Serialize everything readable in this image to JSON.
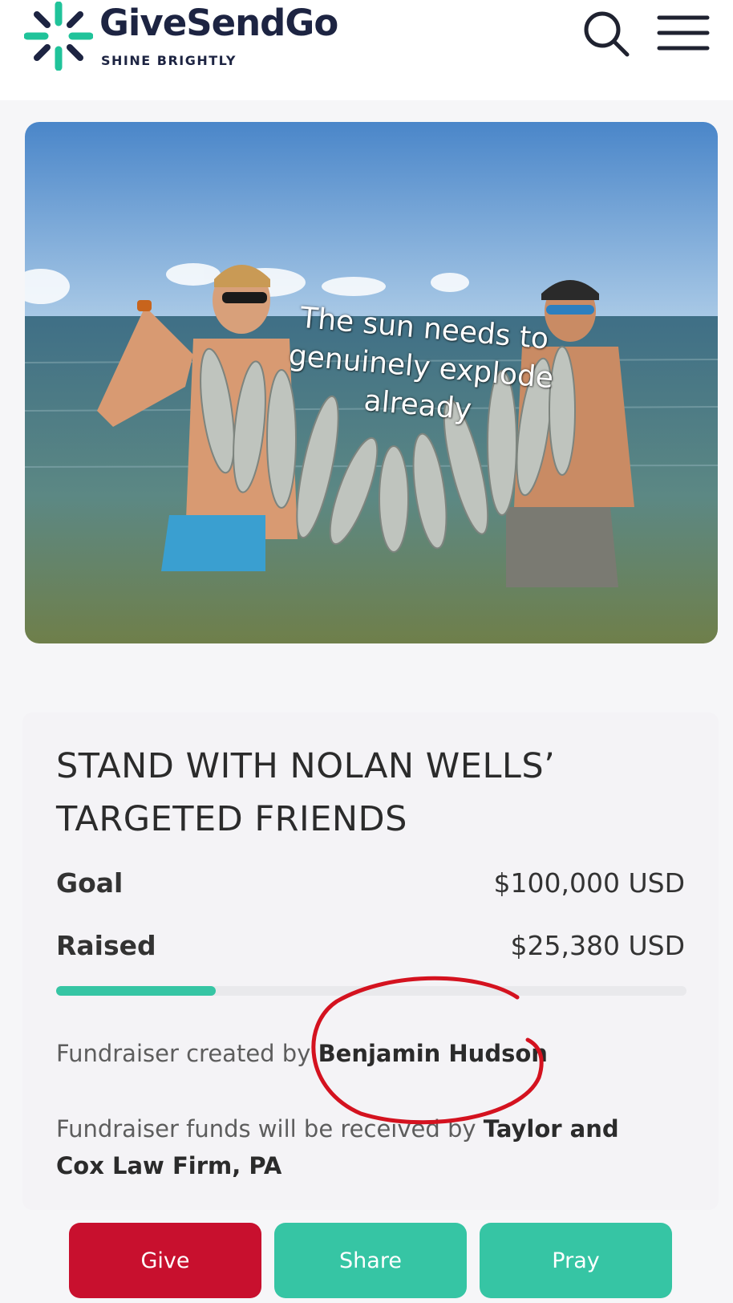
{
  "header": {
    "logo_name": "GiveSendGo",
    "logo_tagline": "SHINE BRIGHTLY"
  },
  "hero": {
    "caption": "The sun needs to genuinely explode already"
  },
  "fundraiser": {
    "title": "STAND WITH NOLAN WELLS’ TARGETED FRIENDS",
    "goal_label": "Goal",
    "goal_value": "$100,000 USD",
    "raised_label": "Raised",
    "raised_value": "$25,380 USD",
    "progress_fraction": 0.2538,
    "created_prefix": "Fundraiser created by ",
    "creator": "Benjamin Hudson",
    "recipient_prefix": "Fundraiser funds will be received by ",
    "recipient": "Taylor and Cox Law Firm, PA"
  },
  "actions": {
    "give": "Give",
    "share": "Share",
    "pray": "Pray"
  },
  "colors": {
    "brand_navy": "#1d2442",
    "brand_teal": "#20c39a",
    "give_red": "#c8102e",
    "action_teal": "#36c5a4",
    "annotation_red": "#d4121f"
  }
}
